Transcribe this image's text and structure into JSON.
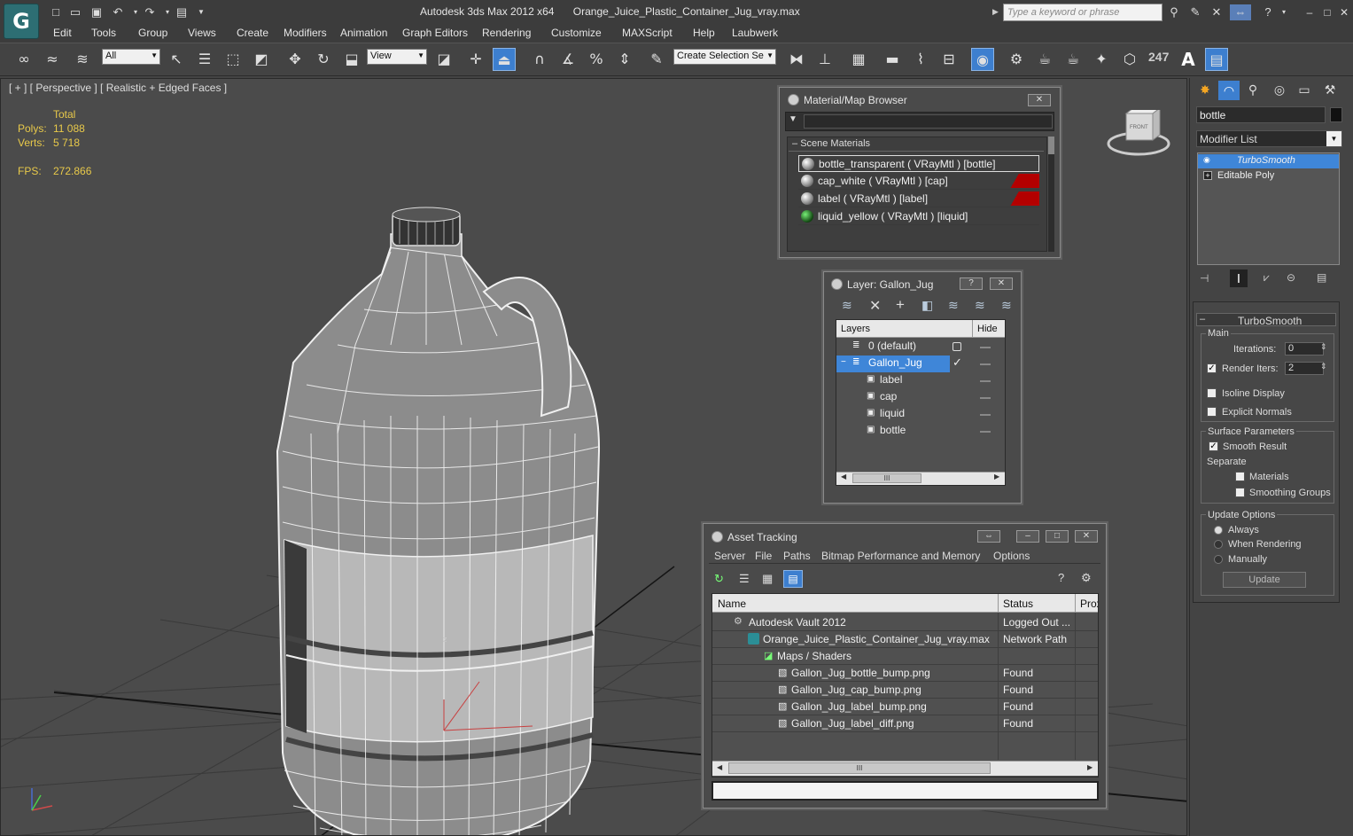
{
  "app": {
    "logo_glyph": "G",
    "title": "Autodesk 3ds Max  2012 x64",
    "filename": "Orange_Juice_Plastic_Container_Jug_vray.max",
    "search_placeholder": "Type a keyword or phrase"
  },
  "menu": [
    "Edit",
    "Tools",
    "Group",
    "Views",
    "Create",
    "Modifiers",
    "Animation",
    "Graph Editors",
    "Rendering",
    "Customize",
    "MAXScript",
    "Help",
    "Laubwerk"
  ],
  "toolbar": {
    "selection_filter": "All",
    "ref_coord": "View",
    "selection_set": "Create Selection Se",
    "counter": "247"
  },
  "viewport": {
    "label": "[ + ] [ Perspective ] [ Realistic + Edged Faces ]",
    "stats_header": "Total",
    "polys_label": "Polys:",
    "polys_value": "11 088",
    "verts_label": "Verts:",
    "verts_value": "5 718",
    "fps_label": "FPS:",
    "fps_value": "272.866",
    "viewcube_label": "FRONT",
    "gizmo_axis": "z"
  },
  "material_browser": {
    "title": "Material/Map Browser",
    "section": "Scene Materials",
    "materials": [
      "bottle_transparent  ( VRayMtl )  [bottle]",
      "cap_white  ( VRayMtl )  [cap]",
      "label  ( VRayMtl )  [label]",
      "liquid_yellow  ( VRayMtl )  [liquid]"
    ]
  },
  "layer_window": {
    "title": "Layer: Gallon_Jug",
    "help": "?",
    "col_layers": "Layers",
    "col_hide": "Hide",
    "rows": [
      {
        "name": "0 (default)",
        "indent": 0
      },
      {
        "name": "Gallon_Jug",
        "indent": 0
      },
      {
        "name": "label",
        "indent": 1
      },
      {
        "name": "cap",
        "indent": 1
      },
      {
        "name": "liquid",
        "indent": 1
      },
      {
        "name": "bottle",
        "indent": 1
      }
    ]
  },
  "asset_tracking": {
    "title": "Asset Tracking",
    "menus": [
      "Server",
      "File",
      "Paths",
      "Bitmap Performance and Memory",
      "Options"
    ],
    "col_name": "Name",
    "col_status": "Status",
    "col_prox": "Prox",
    "rows": [
      {
        "name": "Autodesk Vault 2012",
        "status": "Logged Out ...",
        "indent": 1
      },
      {
        "name": "Orange_Juice_Plastic_Container_Jug_vray.max",
        "status": "Network Path",
        "indent": 2
      },
      {
        "name": "Maps / Shaders",
        "status": "",
        "indent": 3
      },
      {
        "name": "Gallon_Jug_bottle_bump.png",
        "status": "Found",
        "indent": 4
      },
      {
        "name": "Gallon_Jug_cap_bump.png",
        "status": "Found",
        "indent": 4
      },
      {
        "name": "Gallon_Jug_label_bump.png",
        "status": "Found",
        "indent": 4
      },
      {
        "name": "Gallon_Jug_label_diff.png",
        "status": "Found",
        "indent": 4
      }
    ],
    "scroll_glyph": "III"
  },
  "command_panel": {
    "object_name": "bottle",
    "modifier_list": "Modifier List",
    "stack": [
      "TurboSmooth",
      "Editable Poly"
    ],
    "rollout_title": "TurboSmooth",
    "main_label": "Main",
    "iterations_label": "Iterations:",
    "iterations_value": "0",
    "render_iters_label": "Render Iters:",
    "render_iters_value": "2",
    "isoline": "Isoline Display",
    "explicit": "Explicit Normals",
    "surface_params": "Surface Parameters",
    "smooth_result": "Smooth Result",
    "separate": "Separate",
    "materials": "Materials",
    "smoothing_groups": "Smoothing Groups",
    "update_options": "Update Options",
    "always": "Always",
    "when_rendering": "When Rendering",
    "manually": "Manually",
    "update_button": "Update"
  },
  "colors": {
    "accent_blue": "#3f86d8",
    "stat_yellow": "#e8c94a",
    "flag_red": "#b30000",
    "logo_teal": "#2d6e73"
  }
}
